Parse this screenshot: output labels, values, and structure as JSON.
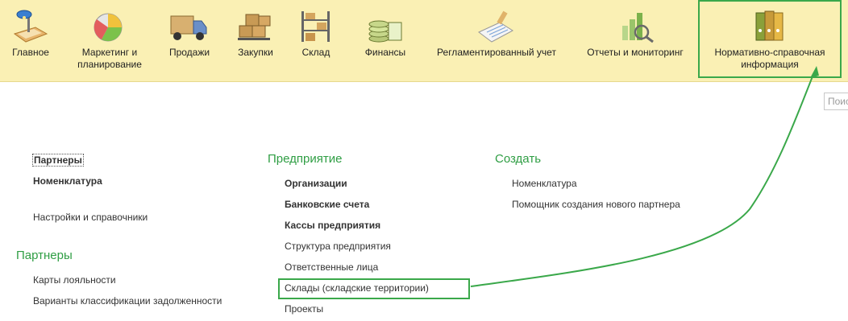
{
  "sections": [
    {
      "label": "Главное",
      "icon": "desk-lamp-icon"
    },
    {
      "label": "Маркетинг и\nпланирование",
      "icon": "pie-chart-icon"
    },
    {
      "label": "Продажи",
      "icon": "delivery-truck-icon"
    },
    {
      "label": "Закупки",
      "icon": "boxes-cart-icon"
    },
    {
      "label": "Склад",
      "icon": "warehouse-shelf-icon"
    },
    {
      "label": "Финансы",
      "icon": "coins-stack-icon"
    },
    {
      "label": "Регламентированный учет",
      "icon": "ledger-document-icon"
    },
    {
      "label": "Отчеты и мониторинг",
      "icon": "bar-report-icon"
    },
    {
      "label": "Нормативно-справочная\nинформация",
      "icon": "binders-icon"
    }
  ],
  "search": {
    "placeholder": "Поис"
  },
  "left_column": {
    "top_links": [
      "Партнеры",
      "Номенклатура"
    ],
    "settings_link": "Настройки и справочники",
    "partners_heading": "Партнеры",
    "partners_links": [
      "Карты лояльности",
      "Варианты классификации задолженности"
    ]
  },
  "middle_column": {
    "heading": "Предприятие",
    "links": [
      "Организации",
      "Банковские счета",
      "Кассы предприятия",
      "Структура предприятия",
      "Ответственные лица",
      "Склады (складские территории)",
      "Проекты"
    ]
  },
  "right_column": {
    "heading": "Создать",
    "links": [
      "Номенклатура",
      "Помощник создания нового партнера"
    ]
  },
  "colors": {
    "highlight": "#3aa84a",
    "heading": "#2f9e44",
    "toolbar": "#faf0b4"
  }
}
